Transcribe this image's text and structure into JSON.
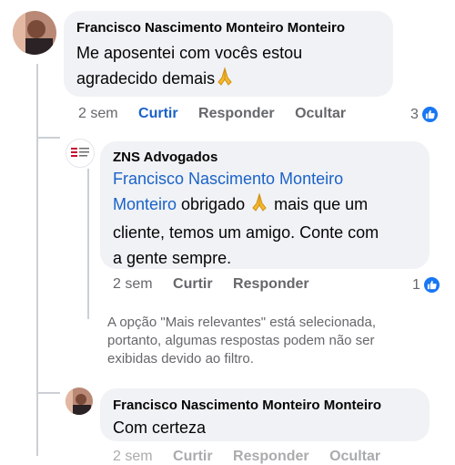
{
  "comments": [
    {
      "author": "Francisco Nascimento Monteiro Monteiro",
      "text_line1": "Me aposentei com vocês estou",
      "text_line2": "agradecido demais",
      "emoji": "pray-emoji",
      "time": "2 sem",
      "like_label": "Curtir",
      "reply_label": "Responder",
      "hide_label": "Ocultar",
      "reaction_count": "3"
    },
    {
      "author": "ZNS Advogados",
      "mention_line1": "Francisco Nascimento Monteiro",
      "mention_line2": "Monteiro",
      "text_after_mention": " obrigado ",
      "text_after_emoji": " mais que um",
      "text_line3": "cliente, temos um amigo. Conte com",
      "text_line4": "a gente sempre.",
      "emoji": "pray-emoji",
      "time": "2 sem",
      "like_label": "Curtir",
      "reply_label": "Responder",
      "reaction_count": "1"
    },
    {
      "author": "Francisco Nascimento Monteiro Monteiro",
      "text": "Com certeza",
      "time": "2 sem",
      "like_label": "Curtir",
      "reply_label": "Responder",
      "hide_label": "Ocultar"
    }
  ],
  "filter_note": {
    "line1": "A opção \"Mais relevantes\" está selecionada,",
    "line2": "portanto, algumas respostas podem não ser",
    "line3": "exibidas devido ao filtro."
  },
  "colors": {
    "bubble": "#f0f2f5",
    "mention": "#1b62c8",
    "meta": "#65676b",
    "like_badge": "#1877f2"
  }
}
